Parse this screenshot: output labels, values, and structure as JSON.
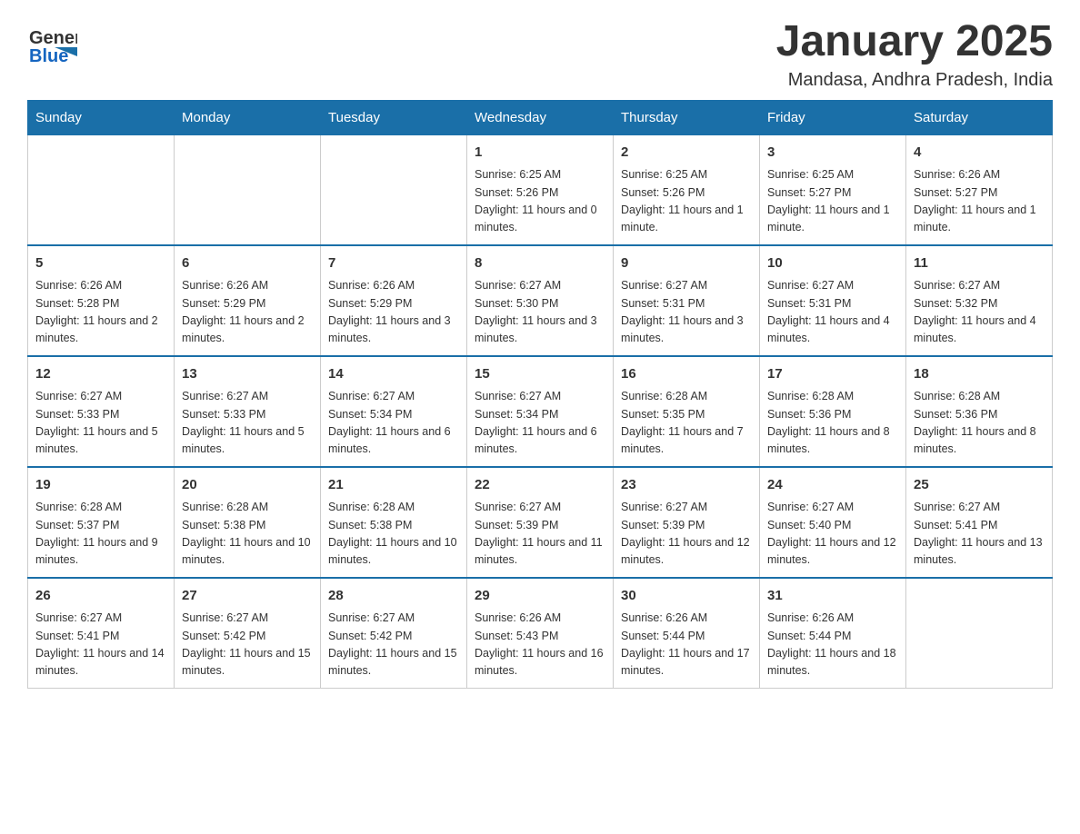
{
  "header": {
    "logo_line1": "General",
    "logo_line2": "Blue",
    "title": "January 2025",
    "subtitle": "Mandasa, Andhra Pradesh, India"
  },
  "days_of_week": [
    "Sunday",
    "Monday",
    "Tuesday",
    "Wednesday",
    "Thursday",
    "Friday",
    "Saturday"
  ],
  "weeks": [
    [
      {
        "day": "",
        "info": ""
      },
      {
        "day": "",
        "info": ""
      },
      {
        "day": "",
        "info": ""
      },
      {
        "day": "1",
        "info": "Sunrise: 6:25 AM\nSunset: 5:26 PM\nDaylight: 11 hours and 0 minutes."
      },
      {
        "day": "2",
        "info": "Sunrise: 6:25 AM\nSunset: 5:26 PM\nDaylight: 11 hours and 1 minute."
      },
      {
        "day": "3",
        "info": "Sunrise: 6:25 AM\nSunset: 5:27 PM\nDaylight: 11 hours and 1 minute."
      },
      {
        "day": "4",
        "info": "Sunrise: 6:26 AM\nSunset: 5:27 PM\nDaylight: 11 hours and 1 minute."
      }
    ],
    [
      {
        "day": "5",
        "info": "Sunrise: 6:26 AM\nSunset: 5:28 PM\nDaylight: 11 hours and 2 minutes."
      },
      {
        "day": "6",
        "info": "Sunrise: 6:26 AM\nSunset: 5:29 PM\nDaylight: 11 hours and 2 minutes."
      },
      {
        "day": "7",
        "info": "Sunrise: 6:26 AM\nSunset: 5:29 PM\nDaylight: 11 hours and 3 minutes."
      },
      {
        "day": "8",
        "info": "Sunrise: 6:27 AM\nSunset: 5:30 PM\nDaylight: 11 hours and 3 minutes."
      },
      {
        "day": "9",
        "info": "Sunrise: 6:27 AM\nSunset: 5:31 PM\nDaylight: 11 hours and 3 minutes."
      },
      {
        "day": "10",
        "info": "Sunrise: 6:27 AM\nSunset: 5:31 PM\nDaylight: 11 hours and 4 minutes."
      },
      {
        "day": "11",
        "info": "Sunrise: 6:27 AM\nSunset: 5:32 PM\nDaylight: 11 hours and 4 minutes."
      }
    ],
    [
      {
        "day": "12",
        "info": "Sunrise: 6:27 AM\nSunset: 5:33 PM\nDaylight: 11 hours and 5 minutes."
      },
      {
        "day": "13",
        "info": "Sunrise: 6:27 AM\nSunset: 5:33 PM\nDaylight: 11 hours and 5 minutes."
      },
      {
        "day": "14",
        "info": "Sunrise: 6:27 AM\nSunset: 5:34 PM\nDaylight: 11 hours and 6 minutes."
      },
      {
        "day": "15",
        "info": "Sunrise: 6:27 AM\nSunset: 5:34 PM\nDaylight: 11 hours and 6 minutes."
      },
      {
        "day": "16",
        "info": "Sunrise: 6:28 AM\nSunset: 5:35 PM\nDaylight: 11 hours and 7 minutes."
      },
      {
        "day": "17",
        "info": "Sunrise: 6:28 AM\nSunset: 5:36 PM\nDaylight: 11 hours and 8 minutes."
      },
      {
        "day": "18",
        "info": "Sunrise: 6:28 AM\nSunset: 5:36 PM\nDaylight: 11 hours and 8 minutes."
      }
    ],
    [
      {
        "day": "19",
        "info": "Sunrise: 6:28 AM\nSunset: 5:37 PM\nDaylight: 11 hours and 9 minutes."
      },
      {
        "day": "20",
        "info": "Sunrise: 6:28 AM\nSunset: 5:38 PM\nDaylight: 11 hours and 10 minutes."
      },
      {
        "day": "21",
        "info": "Sunrise: 6:28 AM\nSunset: 5:38 PM\nDaylight: 11 hours and 10 minutes."
      },
      {
        "day": "22",
        "info": "Sunrise: 6:27 AM\nSunset: 5:39 PM\nDaylight: 11 hours and 11 minutes."
      },
      {
        "day": "23",
        "info": "Sunrise: 6:27 AM\nSunset: 5:39 PM\nDaylight: 11 hours and 12 minutes."
      },
      {
        "day": "24",
        "info": "Sunrise: 6:27 AM\nSunset: 5:40 PM\nDaylight: 11 hours and 12 minutes."
      },
      {
        "day": "25",
        "info": "Sunrise: 6:27 AM\nSunset: 5:41 PM\nDaylight: 11 hours and 13 minutes."
      }
    ],
    [
      {
        "day": "26",
        "info": "Sunrise: 6:27 AM\nSunset: 5:41 PM\nDaylight: 11 hours and 14 minutes."
      },
      {
        "day": "27",
        "info": "Sunrise: 6:27 AM\nSunset: 5:42 PM\nDaylight: 11 hours and 15 minutes."
      },
      {
        "day": "28",
        "info": "Sunrise: 6:27 AM\nSunset: 5:42 PM\nDaylight: 11 hours and 15 minutes."
      },
      {
        "day": "29",
        "info": "Sunrise: 6:26 AM\nSunset: 5:43 PM\nDaylight: 11 hours and 16 minutes."
      },
      {
        "day": "30",
        "info": "Sunrise: 6:26 AM\nSunset: 5:44 PM\nDaylight: 11 hours and 17 minutes."
      },
      {
        "day": "31",
        "info": "Sunrise: 6:26 AM\nSunset: 5:44 PM\nDaylight: 11 hours and 18 minutes."
      },
      {
        "day": "",
        "info": ""
      }
    ]
  ]
}
